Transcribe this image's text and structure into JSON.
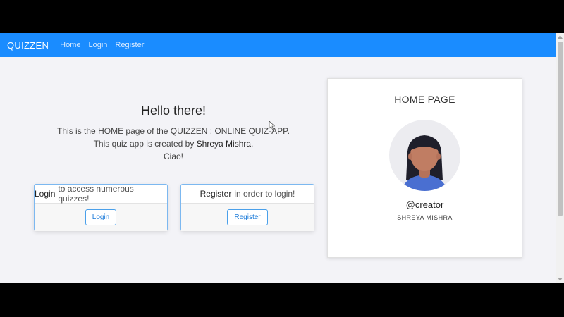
{
  "navbar": {
    "brand": "QUIZZEN",
    "links": [
      "Home",
      "Login",
      "Register"
    ],
    "color": "#1a8cff"
  },
  "hero": {
    "title": "Hello there!",
    "line1": "This is the HOME page of the QUIZZEN : ONLINE QUIZ-APP.",
    "line2_prefix": "This quiz app is created by ",
    "line2_name": "Shreya Mishra",
    "line2_suffix": ".",
    "line3": "Ciao!"
  },
  "login_card": {
    "bold": "Login",
    "rest": "to access numerous quizzes!",
    "button": "Login"
  },
  "register_card": {
    "bold": "Register",
    "rest": "in order to login!",
    "button": "Register"
  },
  "profile": {
    "title": "HOME PAGE",
    "handle": "@creator",
    "name": "SHREYA MISHRA",
    "avatar_icon": "woman-avatar-icon"
  }
}
